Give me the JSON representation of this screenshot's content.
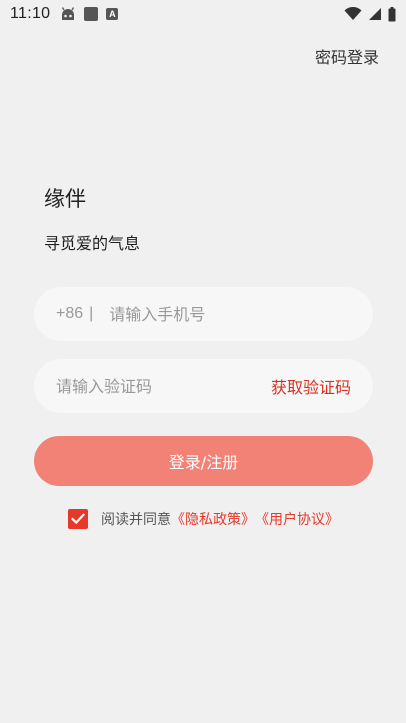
{
  "status_bar": {
    "time": "11:10",
    "a_badge": "A"
  },
  "header": {
    "password_login": "密码登录"
  },
  "brand": {
    "app_name": "缘伴",
    "tagline": "寻觅爱的气息"
  },
  "phone_field": {
    "country_code": "+86",
    "divider": "|",
    "placeholder": "请输入手机号"
  },
  "code_field": {
    "placeholder": "请输入验证码",
    "get_code": "获取验证码"
  },
  "login_button": {
    "label": "登录/注册"
  },
  "agreement": {
    "checked": true,
    "prefix": "阅读并同意",
    "privacy_policy": "《隐私政策》",
    "user_agreement": "《用户协议》"
  },
  "colors": {
    "accent": "#e8382a",
    "button": "#f28276",
    "background": "#f0f0f0"
  }
}
